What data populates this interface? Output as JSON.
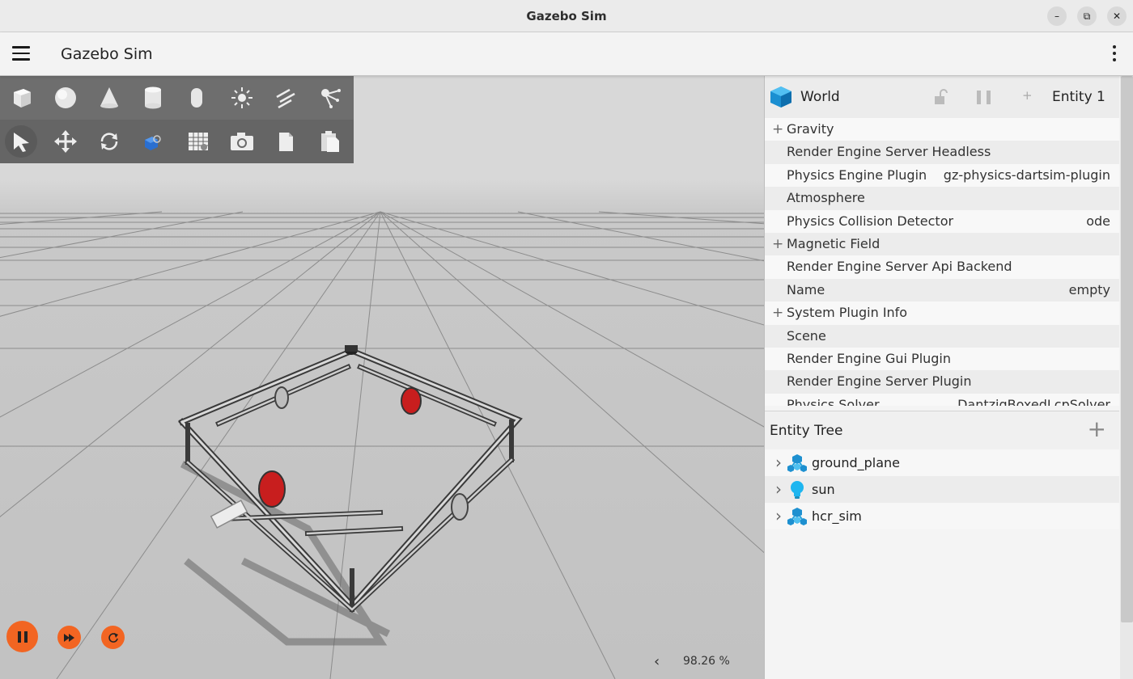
{
  "window": {
    "title": "Gazebo Sim"
  },
  "header": {
    "title": "Gazebo Sim"
  },
  "toolbar": {
    "shapes": [
      "box-icon",
      "sphere-icon",
      "cone-icon",
      "cylinder-icon",
      "capsule-icon",
      "point-light-icon",
      "directional-light-icon",
      "spot-light-icon"
    ],
    "tools": [
      "select-icon",
      "translate-icon",
      "rotate-icon",
      "transform-icon",
      "grid-config-icon",
      "screenshot-icon",
      "copy-icon",
      "paste-icon"
    ],
    "selected_tool": "select-icon"
  },
  "playback": {
    "real_time_factor": "98.26 %"
  },
  "component_inspector": {
    "entity_name": "World",
    "entity_id": "Entity 1",
    "components": [
      {
        "label": "Gravity",
        "value": "",
        "expandable": true
      },
      {
        "label": "Render Engine Server Headless",
        "value": "",
        "expandable": false
      },
      {
        "label": "Physics Engine Plugin",
        "value": "gz-physics-dartsim-plugin",
        "expandable": false
      },
      {
        "label": "Atmosphere",
        "value": "",
        "expandable": false
      },
      {
        "label": "Physics Collision Detector",
        "value": "ode",
        "expandable": false
      },
      {
        "label": "Magnetic Field",
        "value": "",
        "expandable": true
      },
      {
        "label": "Render Engine Server Api Backend",
        "value": "",
        "expandable": false
      },
      {
        "label": "Name",
        "value": "empty",
        "expandable": false
      },
      {
        "label": "System Plugin Info",
        "value": "",
        "expandable": true
      },
      {
        "label": "Scene",
        "value": "",
        "expandable": false
      },
      {
        "label": "Render Engine Gui Plugin",
        "value": "",
        "expandable": false
      },
      {
        "label": "Render Engine Server Plugin",
        "value": "",
        "expandable": false
      },
      {
        "label": "Physics Solver",
        "value": "DantzigBoxedLcpSolver",
        "expandable": false
      }
    ]
  },
  "entity_tree": {
    "title": "Entity Tree",
    "items": [
      {
        "label": "ground_plane",
        "icon": "model-icon"
      },
      {
        "label": "sun",
        "icon": "light-bulb-icon"
      },
      {
        "label": "hcr_sim",
        "icon": "model-icon"
      }
    ]
  },
  "colors": {
    "accent": "#f26522",
    "toolbar_bg": "#6b6b6b",
    "robot_red": "#cc1f1f"
  }
}
